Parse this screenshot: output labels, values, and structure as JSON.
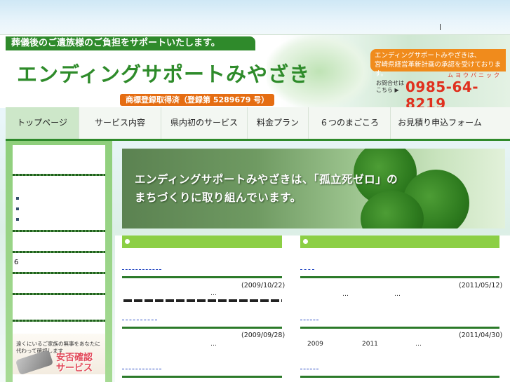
{
  "header": {
    "tagline": "葬儀後のご遺族様のご負担をサポートいたします。",
    "logo_text": "エンディングサポートみやざき",
    "trademark": "商標登録取得済（登録第 5289679 号）",
    "notice_line1": "エンディングサポートみやざきは、",
    "notice_line2": "宮崎県経営革新計画の承認を受けております。",
    "contact_label_1": "お問合せは",
    "contact_label_2": "こちら ▶",
    "phone_kana": "ムヨウパニック",
    "phone": "0985-64-8219"
  },
  "nav": {
    "items": [
      {
        "label": "トップページ",
        "active": true
      },
      {
        "label": "サービス内容"
      },
      {
        "label": "県内初のサービス"
      },
      {
        "label": "料金プラン"
      },
      {
        "label": "６つのまごころ"
      },
      {
        "label": "お見積り申込フォーム"
      }
    ]
  },
  "sidebar": {
    "number": "6",
    "banner_top": "遠くにいるご家族の無事をあなたに代わって確認します",
    "banner_label_1": "安否確認",
    "banner_label_2": "サービス"
  },
  "main_banner": {
    "line1": "エンディングサポートみやざきは、「孤立死ゼロ」の",
    "line2": "まちづくりに取り組んでいます。"
  },
  "news_left": {
    "items": [
      {
        "date": "(2009/10/22)",
        "dots": "…"
      },
      {
        "date": "(2009/09/28)",
        "dots": "…"
      },
      {
        "date": ""
      }
    ]
  },
  "news_right": {
    "items": [
      {
        "date": "(2011/05/12)",
        "dots1": "…",
        "dots2": "…"
      },
      {
        "date": "(2011/04/30)",
        "year1": "2009",
        "year2": "2011",
        "dots": "…"
      },
      {
        "date": ""
      }
    ]
  },
  "colors": {
    "brand_green": "#2f8a2b",
    "accent_orange": "#f08b1c",
    "phone_red": "#e0301e",
    "head_green": "#8ccf45"
  }
}
